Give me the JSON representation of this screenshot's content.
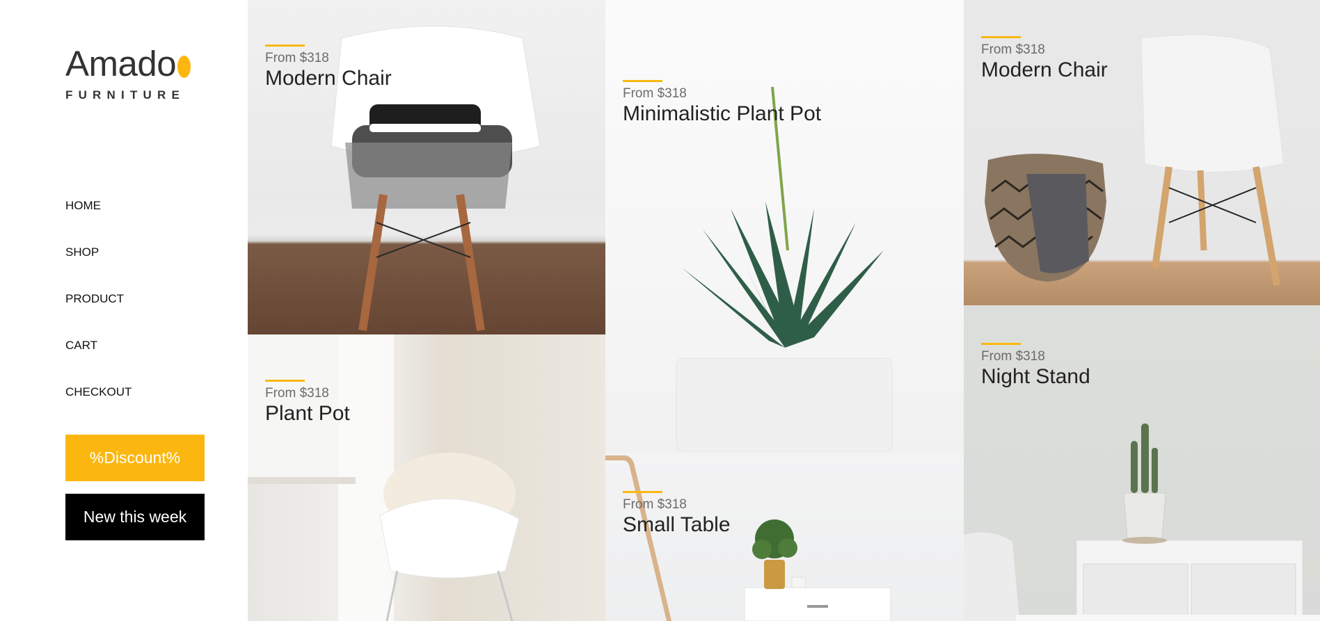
{
  "brand": {
    "name": "Amado",
    "subtitle": "FURNITURE",
    "accent_color": "#fbb710"
  },
  "nav": {
    "items": [
      {
        "label": "HOME"
      },
      {
        "label": "SHOP"
      },
      {
        "label": "PRODUCT"
      },
      {
        "label": "CART"
      },
      {
        "label": "CHECKOUT"
      }
    ]
  },
  "buttons": {
    "discount_label": "%Discount%",
    "new_label": "New this week"
  },
  "products": [
    {
      "price": "From $318",
      "name": "Modern Chair"
    },
    {
      "price": "From $318",
      "name": "Plant Pot"
    },
    {
      "price": "From $318",
      "name": "Minimalistic Plant Pot"
    },
    {
      "price": "From $318",
      "name": "Small Table"
    },
    {
      "price": "From $318",
      "name": "Modern Chair"
    },
    {
      "price": "From $318",
      "name": "Night Stand"
    }
  ]
}
